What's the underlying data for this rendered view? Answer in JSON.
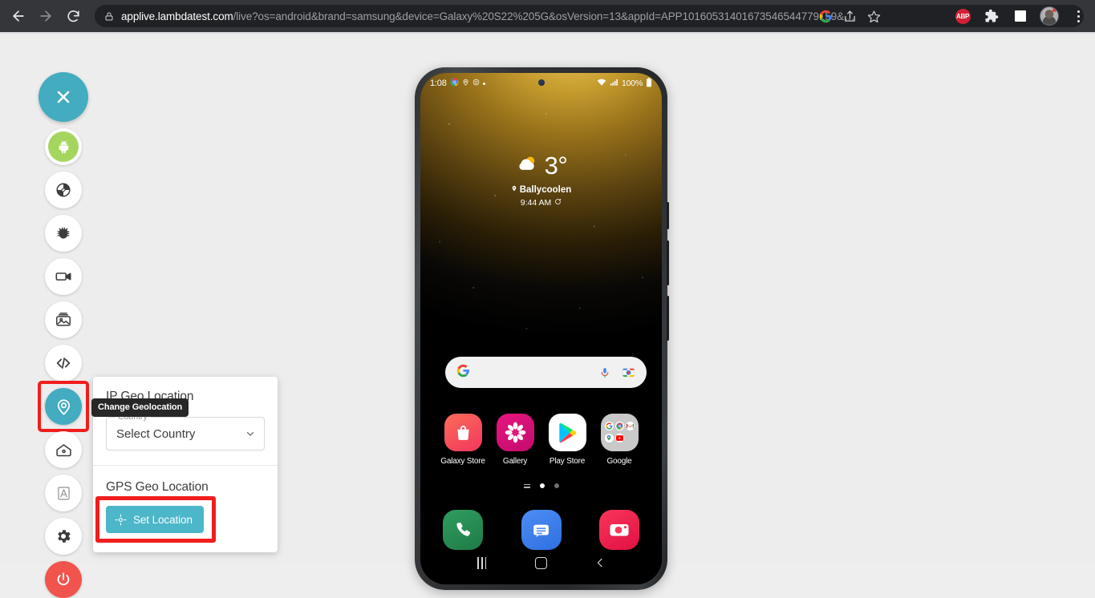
{
  "browser": {
    "back_label": "Back",
    "forward_label": "Forward",
    "reload_label": "Reload",
    "url_host": "applive.lambdatest.com",
    "url_path": "/live?os=android&brand=samsung&device=Galaxy%20S22%205G&osVersion=13&appId=APP10160531401673546544779159&…",
    "lock_label": "Site information",
    "google_label": "Google",
    "share_label": "Share this page",
    "bookmark_label": "Bookmark this tab",
    "abp_label": "ABP",
    "extensions_label": "Extensions",
    "sidepanel_label": "Side panel",
    "profile_label": "Profile",
    "menu_label": "Customize and control Google Chrome"
  },
  "rail": {
    "items": [
      {
        "name": "close",
        "label": "Close",
        "icon": "close-icon"
      },
      {
        "name": "android",
        "label": "Android",
        "icon": "android-icon"
      },
      {
        "name": "rotate",
        "label": "Rotate Device",
        "icon": "rotate-icon"
      },
      {
        "name": "bug",
        "label": "Report a Bug",
        "icon": "bug-icon"
      },
      {
        "name": "record",
        "label": "Record Video",
        "icon": "video-camera-icon"
      },
      {
        "name": "screenshot",
        "label": "Screenshot",
        "icon": "image-icon"
      },
      {
        "name": "devtools",
        "label": "Dev Tools",
        "icon": "code-icon"
      },
      {
        "name": "geolocation",
        "label": "Change Geolocation",
        "icon": "location-pin-icon"
      },
      {
        "name": "home",
        "label": "Home",
        "icon": "home-icon"
      },
      {
        "name": "whiteboard",
        "label": "Markup",
        "icon": "markup-icon"
      },
      {
        "name": "settings",
        "label": "Settings",
        "icon": "gear-icon"
      },
      {
        "name": "power",
        "label": "Stop Session",
        "icon": "power-icon"
      }
    ],
    "tooltip": "Change Geolocation"
  },
  "geo_panel": {
    "ip_section_title": "IP Geo Location",
    "country_field_label": "Country",
    "country_value": "Select Country",
    "gps_section_title": "GPS Geo Location",
    "set_location_label": "Set Location"
  },
  "phone": {
    "status": {
      "time": "1:08",
      "battery": "100%"
    },
    "weather": {
      "temperature": "3°",
      "location": "Ballycoolen",
      "time": "9:44 AM"
    },
    "search_placeholder": "",
    "apps": [
      {
        "label": "Galaxy Store",
        "icon": "galaxy-store-icon"
      },
      {
        "label": "Gallery",
        "icon": "gallery-icon"
      },
      {
        "label": "Play Store",
        "icon": "play-store-icon"
      },
      {
        "label": "Google",
        "icon": "google-folder-icon"
      }
    ],
    "google_folder_apps": [
      "G",
      "C",
      "M",
      "P",
      "Y"
    ],
    "dock": [
      {
        "label": "Phone",
        "icon": "phone-icon"
      },
      {
        "label": "Messages",
        "icon": "messages-icon"
      },
      {
        "label": "Camera",
        "icon": "camera-icon"
      }
    ],
    "nav": [
      {
        "label": "Recents",
        "icon": "recents-icon"
      },
      {
        "label": "Home",
        "icon": "home-square-icon"
      },
      {
        "label": "Back",
        "icon": "back-chevron-icon"
      }
    ]
  },
  "colors": {
    "accent_teal": "#43acc0",
    "button_teal": "#4bb7c9",
    "highlight_red": "#f21d1d",
    "android_green": "#a4d65e",
    "power_red": "#f0544c"
  }
}
